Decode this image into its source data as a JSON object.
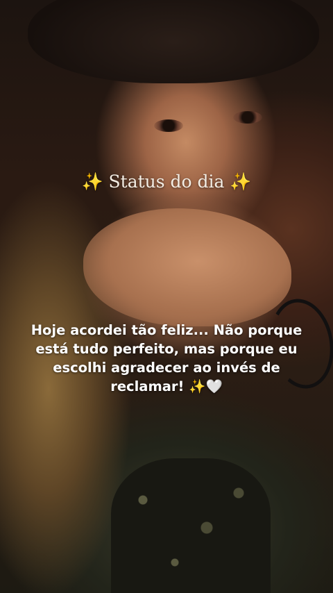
{
  "status_title": "✨ Status do dia ✨",
  "message_lines": [
    "Hoje acordei tão feliz... Não porque",
    "está tudo perfeito, mas porque eu",
    "escolhi agradecer ao invés de",
    "reclamar! ✨🤍"
  ],
  "photo": {
    "subject": "selfie of woman in hat",
    "dominant_colors": [
      "#1a120d",
      "#c48a63",
      "#2b1d14",
      "#3a3a2a"
    ]
  }
}
